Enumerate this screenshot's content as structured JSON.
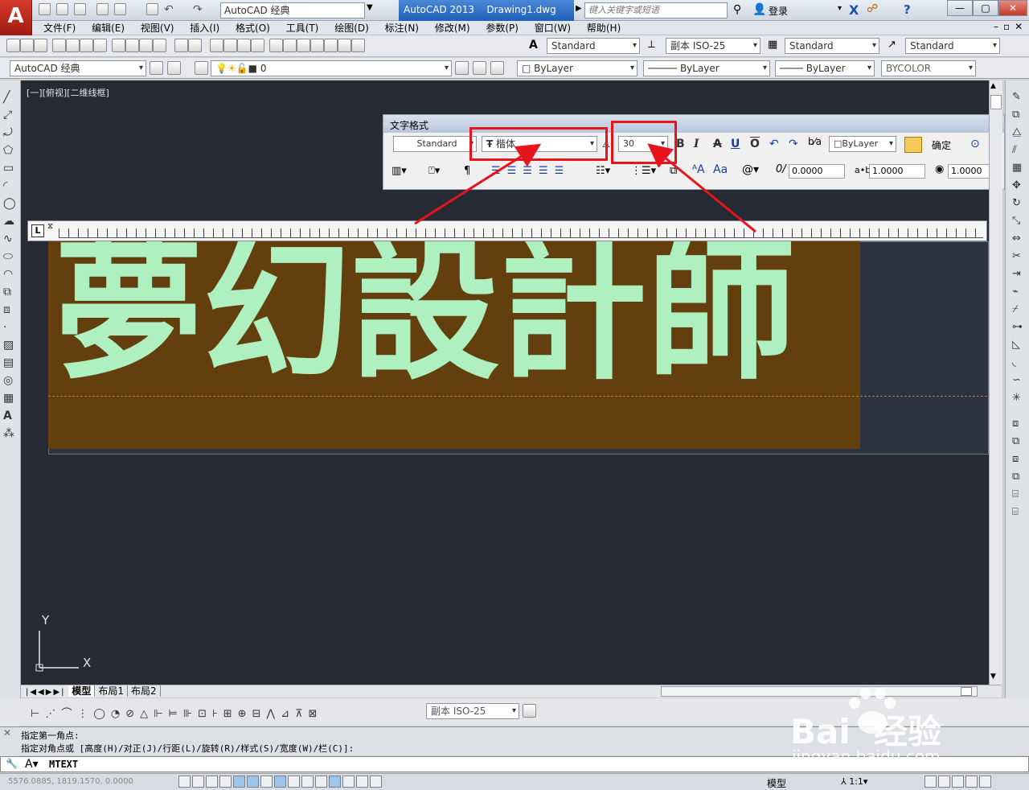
{
  "app": {
    "logo": "A",
    "title_app": "AutoCAD 2013",
    "title_file": "Drawing1.dwg"
  },
  "quick_access": {
    "workspace": "AutoCAD 经典"
  },
  "search": {
    "placeholder": "键入关键字或短语",
    "login": "登录"
  },
  "menus": [
    "文件(F)",
    "编辑(E)",
    "视图(V)",
    "插入(I)",
    "格式(O)",
    "工具(T)",
    "绘图(D)",
    "标注(N)",
    "修改(M)",
    "参数(P)",
    "窗口(W)",
    "帮助(H)"
  ],
  "toolbar1": {
    "text_style": "Standard",
    "dim_style": "副本 ISO-25",
    "table_style": "Standard",
    "mleader_style": "Standard"
  },
  "toolbar2": {
    "workspace": "AutoCAD 经典",
    "layer": "0",
    "color": "ByLayer",
    "linetype": "ByLayer",
    "lineweight": "ByLayer",
    "plot_style": "BYCOLOR"
  },
  "viewport": {
    "label": "[一][俯视][二维线框]"
  },
  "text_format": {
    "title": "文字格式",
    "style": "Standard",
    "font": "楷体",
    "height": "30",
    "bold": "B",
    "italic": "I",
    "strike": "A",
    "underline": "U",
    "overline": "O",
    "color": "ByLayer",
    "ok": "确定",
    "oblique": "0.0000",
    "tracking": "1.0000",
    "width_factor": "1.0000"
  },
  "mtext": {
    "content": "夢幻設計師"
  },
  "ucs": {
    "y_label": "Y",
    "x_label": "X"
  },
  "layout_tabs": [
    "模型",
    "布局1",
    "布局2"
  ],
  "dim_toolbar": {
    "dim_style": "副本 ISO-25"
  },
  "command": {
    "line1": "指定第一角点:",
    "line2": "指定对角点或 [高度(H)/对正(J)/行距(L)/旋转(R)/样式(S)/宽度(W)/栏(C)]:",
    "prompt": "MTEXT"
  },
  "status": {
    "coords": "5576.0885, 1819.1570, 0.0000",
    "model": "模型",
    "scale": "1:1"
  },
  "watermark": {
    "brand": "Bai  经验",
    "url": "jingyan.baidu.com"
  },
  "colors": {
    "accent": "#e8141c",
    "text_fill": "#643f0e",
    "text_color": "#aef0bf",
    "canvas": "#252a35"
  }
}
